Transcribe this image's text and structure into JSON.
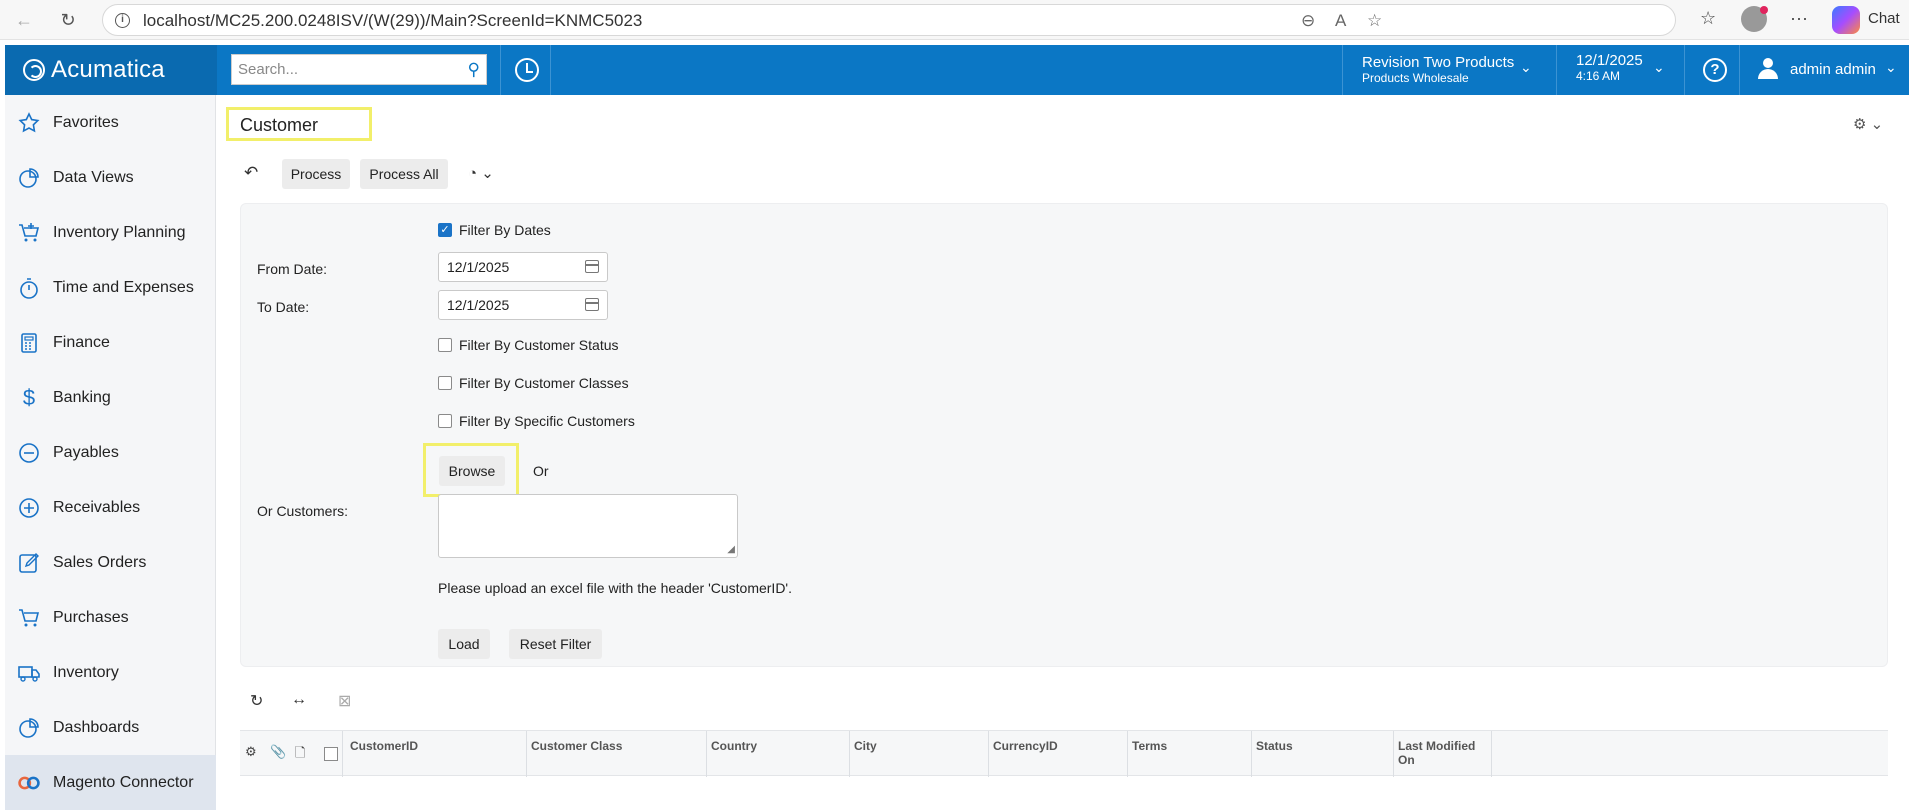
{
  "browser": {
    "url": "localhost/MC25.200.0248ISV/(W(29))/Main?ScreenId=KNMC5023",
    "chat_label": "Chat"
  },
  "topbar": {
    "logo": "Acumatica",
    "search_placeholder": "Search...",
    "company_name": "Revision Two Products",
    "company_sub": "Products Wholesale",
    "date": "12/1/2025",
    "time": "4:16 AM",
    "user": "admin admin",
    "colors": {
      "bar": "#0b77c5",
      "logo_bg": "#0a6ab0"
    }
  },
  "sidebar": {
    "items": [
      {
        "label": "Favorites",
        "icon": "star-icon"
      },
      {
        "label": "Data Views",
        "icon": "pie-chart-icon"
      },
      {
        "label": "Inventory Planning",
        "icon": "cart-plus-icon"
      },
      {
        "label": "Time and Expenses",
        "icon": "stopwatch-icon"
      },
      {
        "label": "Finance",
        "icon": "calculator-icon"
      },
      {
        "label": "Banking",
        "icon": "dollar-icon"
      },
      {
        "label": "Payables",
        "icon": "minus-circle-icon"
      },
      {
        "label": "Receivables",
        "icon": "plus-circle-icon"
      },
      {
        "label": "Sales Orders",
        "icon": "edit-icon"
      },
      {
        "label": "Purchases",
        "icon": "cart-icon"
      },
      {
        "label": "Inventory",
        "icon": "truck-icon"
      },
      {
        "label": "Dashboards",
        "icon": "dashboard-icon"
      },
      {
        "label": "Magento Connector",
        "icon": "magento-icon"
      }
    ]
  },
  "main": {
    "title": "Customer",
    "toolbar": {
      "process": "Process",
      "process_all": "Process All"
    },
    "filters": {
      "filter_by_dates": "Filter By Dates",
      "from_date_label": "From Date:",
      "from_date": "12/1/2025",
      "to_date_label": "To Date:",
      "to_date": "12/1/2025",
      "filter_by_status": "Filter By Customer Status",
      "filter_by_classes": "Filter By Customer Classes",
      "filter_by_specific": "Filter By Specific Customers",
      "browse": "Browse",
      "or": "Or",
      "or_customers_label": "Or Customers:",
      "upload_note": "Please upload an excel file with the header 'CustomerID'.",
      "load": "Load",
      "reset_filter": "Reset Filter",
      "filter_by_dates_checked": true
    },
    "grid": {
      "columns": [
        "CustomerID",
        "Customer Class",
        "Country",
        "City",
        "CurrencyID",
        "Terms",
        "Status",
        "Last Modified On"
      ]
    }
  }
}
